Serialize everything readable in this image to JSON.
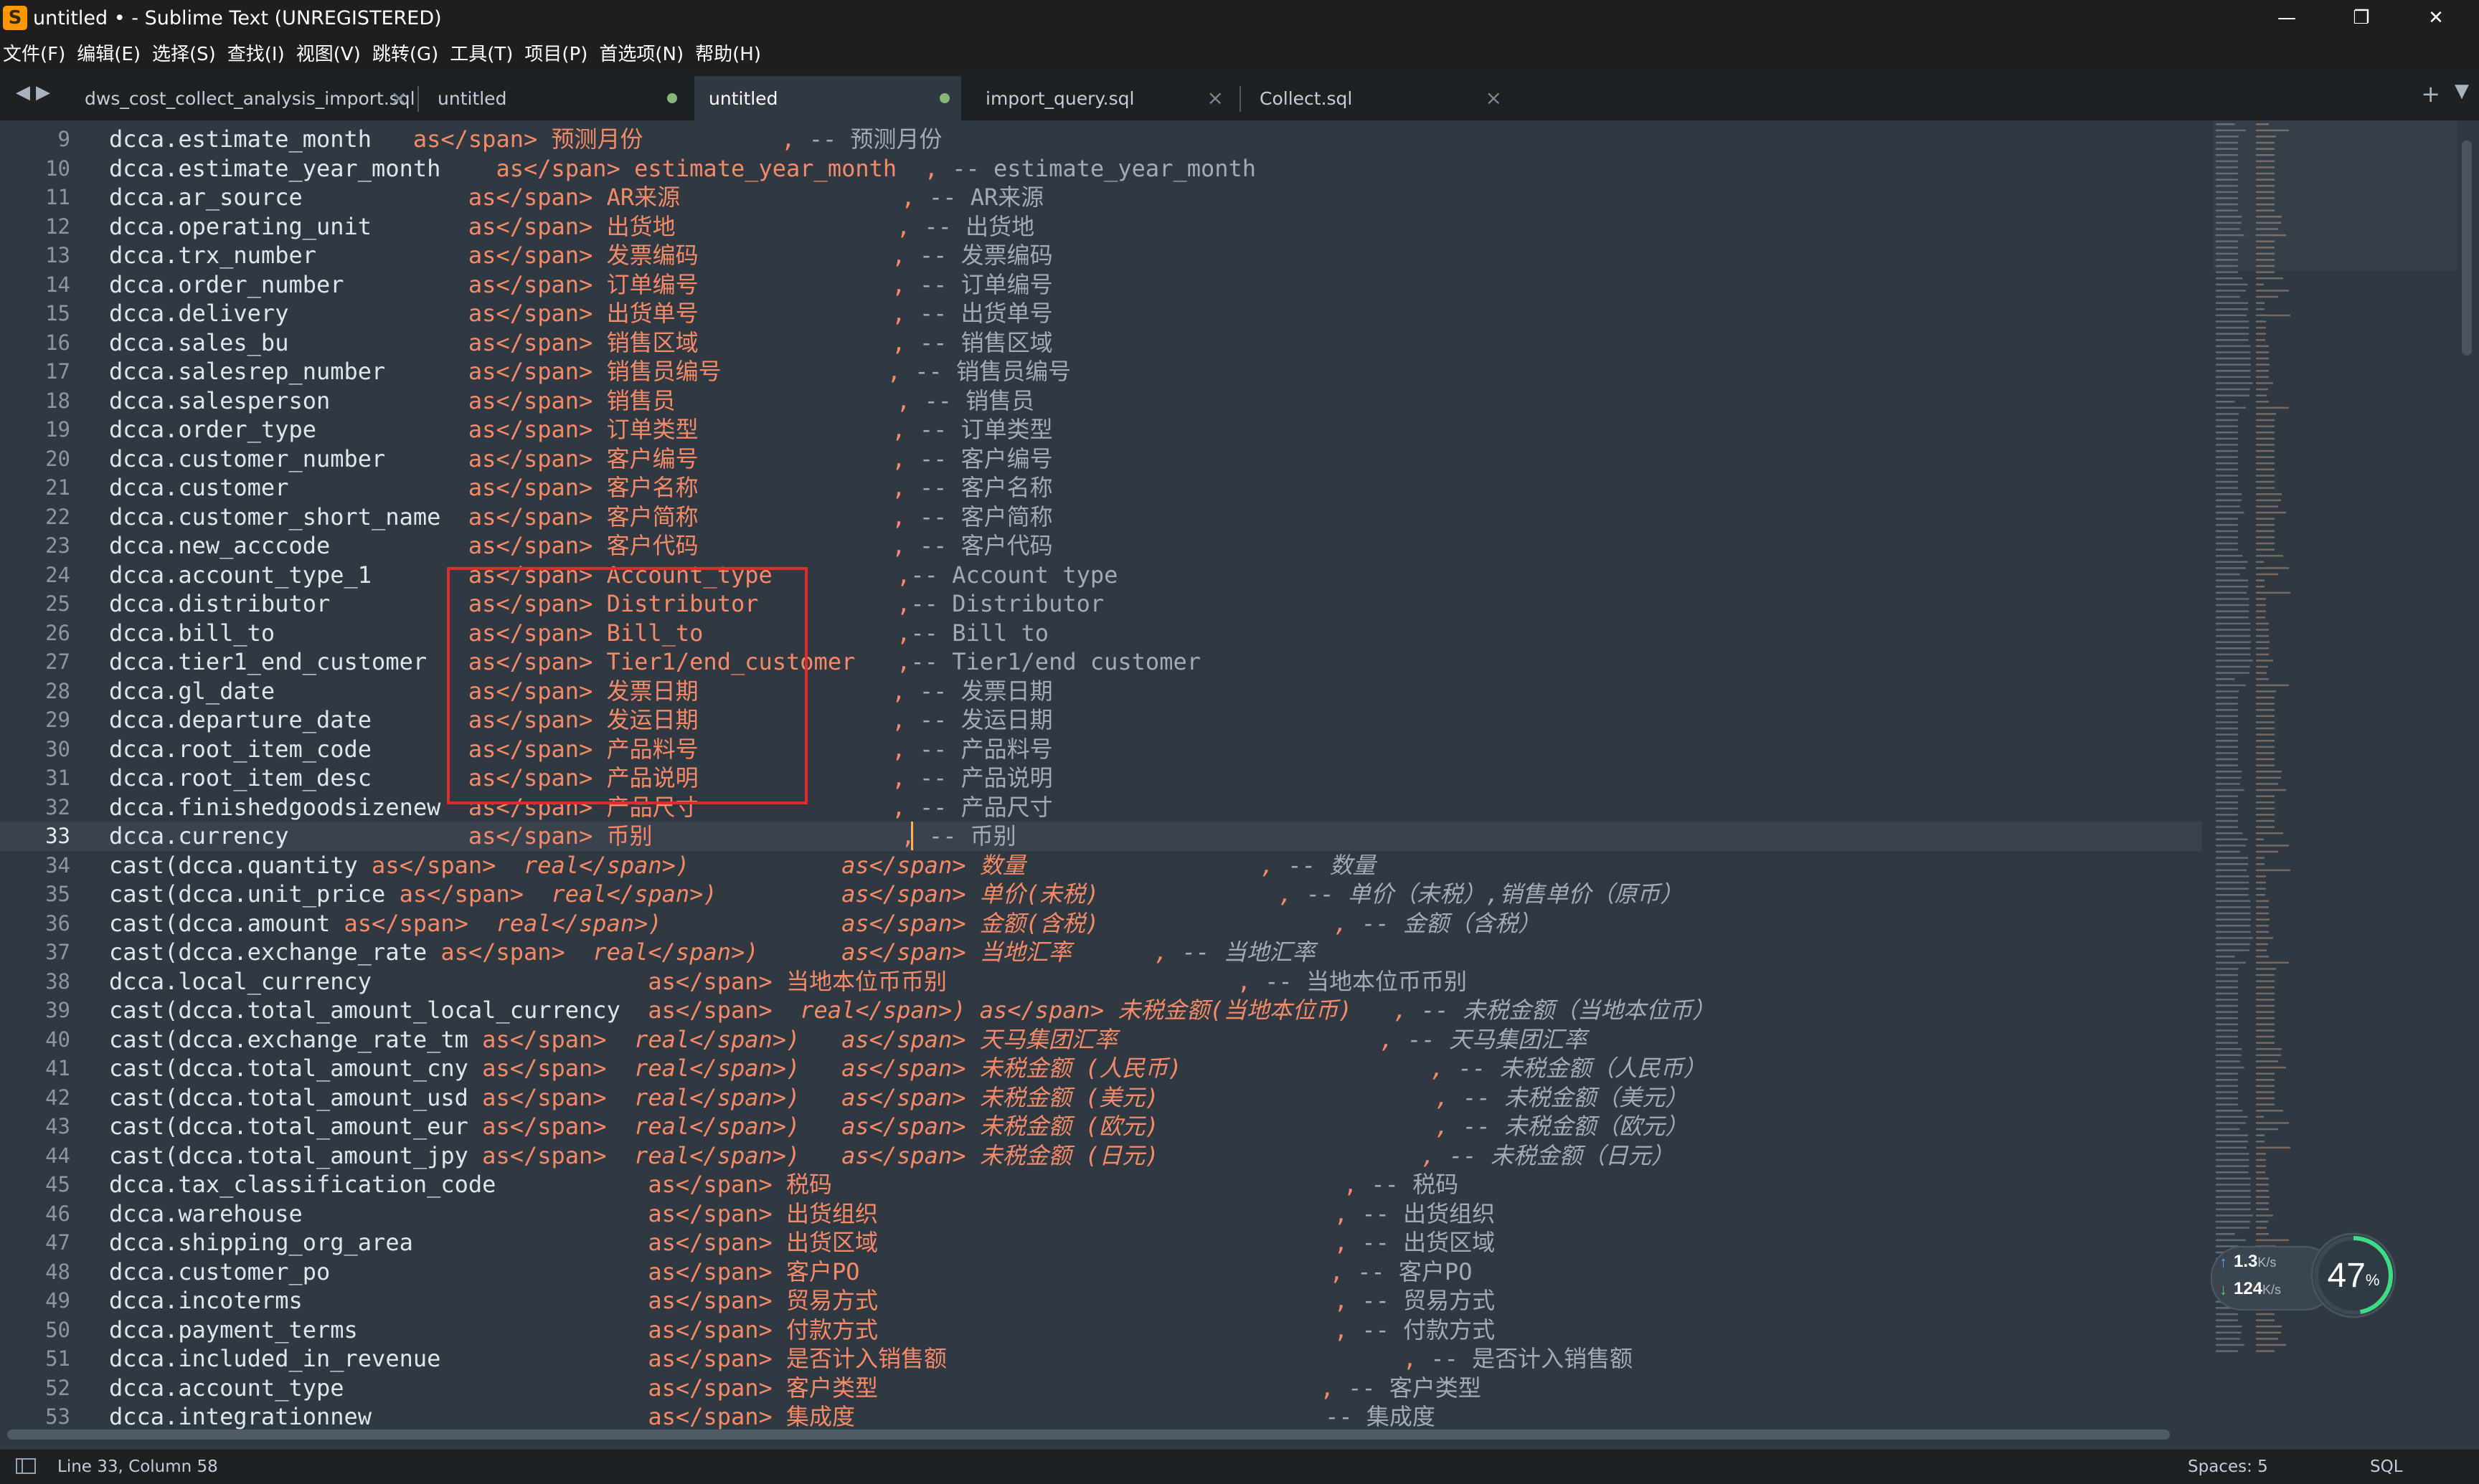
{
  "window": {
    "title": "untitled • - Sublime Text (UNREGISTERED)",
    "app_icon_glyph": "S",
    "minimize": "—",
    "restore": "❐",
    "close": "✕"
  },
  "menu": [
    "文件(F)",
    "编辑(E)",
    "选择(S)",
    "查找(I)",
    "视图(V)",
    "跳转(G)",
    "工具(T)",
    "项目(P)",
    "首选项(N)",
    "帮助(H)"
  ],
  "tabs": [
    {
      "label": "dws_cost_collect_analysis_import.sql",
      "state": "close"
    },
    {
      "label": "untitled",
      "state": "modified"
    },
    {
      "label": "untitled",
      "state": "modified",
      "active": true
    },
    {
      "label": "import_query.sql",
      "state": "close"
    },
    {
      "label": "Collect.sql",
      "state": "close"
    }
  ],
  "editor": {
    "current_line": 33,
    "lines": [
      {
        "n": "9",
        "t": "dcca.estimate_month   as 预测月份          , -- 预测月份"
      },
      {
        "n": "10",
        "t": "dcca.estimate_year_month    as estimate_year_month  , -- estimate_year_month"
      },
      {
        "n": "11",
        "t": "dcca.ar_source            as AR来源                , -- AR来源"
      },
      {
        "n": "12",
        "t": "dcca.operating_unit       as 出货地                , -- 出货地"
      },
      {
        "n": "13",
        "t": "dcca.trx_number           as 发票编码              , -- 发票编码"
      },
      {
        "n": "14",
        "t": "dcca.order_number         as 订单编号              , -- 订单编号"
      },
      {
        "n": "15",
        "t": "dcca.delivery             as 出货单号              , -- 出货单号"
      },
      {
        "n": "16",
        "t": "dcca.sales_bu             as 销售区域              , -- 销售区域"
      },
      {
        "n": "17",
        "t": "dcca.salesrep_number      as 销售员编号            , -- 销售员编号"
      },
      {
        "n": "18",
        "t": "dcca.salesperson          as 销售员                , -- 销售员"
      },
      {
        "n": "19",
        "t": "dcca.order_type           as 订单类型              , -- 订单类型"
      },
      {
        "n": "20",
        "t": "dcca.customer_number      as 客户编号              , -- 客户编号"
      },
      {
        "n": "21",
        "t": "dcca.customer             as 客户名称              , -- 客户名称"
      },
      {
        "n": "22",
        "t": "dcca.customer_short_name  as 客户简称              , -- 客户简称"
      },
      {
        "n": "23",
        "t": "dcca.new_acccode          as 客户代码              , -- 客户代码"
      },
      {
        "n": "24",
        "t": "dcca.account_type_1       as Account_type         ,-- Account type"
      },
      {
        "n": "25",
        "t": "dcca.distributor          as Distributor          ,-- Distributor"
      },
      {
        "n": "26",
        "t": "dcca.bill_to              as Bill_to              ,-- Bill to"
      },
      {
        "n": "27",
        "t": "dcca.tier1_end_customer   as Tier1/end_customer   ,-- Tier1/end customer"
      },
      {
        "n": "28",
        "t": "dcca.gl_date              as 发票日期              , -- 发票日期"
      },
      {
        "n": "29",
        "t": "dcca.departure_date       as 发运日期              , -- 发运日期"
      },
      {
        "n": "30",
        "t": "dcca.root_item_code       as 产品料号              , -- 产品料号"
      },
      {
        "n": "31",
        "t": "dcca.root_item_desc       as 产品说明              , -- 产品说明"
      },
      {
        "n": "32",
        "t": "dcca.finishedgoodsizenew  as 产品尺寸              , -- 产品尺寸"
      },
      {
        "n": "33",
        "t": "dcca.currency             as 币别                  , -- 币别"
      },
      {
        "n": "34",
        "t": "cast(dcca.quantity as  real)           as 数量                 , -- 数量"
      },
      {
        "n": "35",
        "t": "cast(dcca.unit_price as  real)         as 单价(未税)             , -- 单价（未税）,销售单价（原币）"
      },
      {
        "n": "36",
        "t": "cast(dcca.amount as  real)             as 金额(含税)                 , -- 金额（含税）"
      },
      {
        "n": "37",
        "t": "cast(dcca.exchange_rate as  real)      as 当地汇率      , -- 当地汇率"
      },
      {
        "n": "38",
        "t": "dcca.local_currency                    as 当地本位币币别                     , -- 当地本位币币别"
      },
      {
        "n": "39",
        "t": "cast(dcca.total_amount_local_currency  as  real) as 未税金额(当地本位币)   , -- 未税金额（当地本位币）"
      },
      {
        "n": "40",
        "t": "cast(dcca.exchange_rate_tm as  real)   as 天马集团汇率                   , -- 天马集团汇率"
      },
      {
        "n": "41",
        "t": "cast(dcca.total_amount_cny as  real)   as 未税金额 (人民币)                  , -- 未税金额（人民币）"
      },
      {
        "n": "42",
        "t": "cast(dcca.total_amount_usd as  real)   as 未税金额 (美元)                    , -- 未税金额（美元）"
      },
      {
        "n": "43",
        "t": "cast(dcca.total_amount_eur as  real)   as 未税金额 (欧元)                    , -- 未税金额（欧元）"
      },
      {
        "n": "44",
        "t": "cast(dcca.total_amount_jpy as  real)   as 未税金额 (日元)                   , -- 未税金额（日元）"
      },
      {
        "n": "45",
        "t": "dcca.tax_classification_code           as 税码                                     , -- 税码"
      },
      {
        "n": "46",
        "t": "dcca.warehouse                         as 出货组织                                 , -- 出货组织"
      },
      {
        "n": "47",
        "t": "dcca.shipping_org_area                 as 出货区域                                 , -- 出货区域"
      },
      {
        "n": "48",
        "t": "dcca.customer_po                       as 客户PO                                  , -- 客户PO"
      },
      {
        "n": "49",
        "t": "dcca.incoterms                         as 贸易方式                                 , -- 贸易方式"
      },
      {
        "n": "50",
        "t": "dcca.payment_terms                     as 付款方式                                 , -- 付款方式"
      },
      {
        "n": "51",
        "t": "dcca.included_in_revenue               as 是否计入销售额                                 , -- 是否计入销售额"
      },
      {
        "n": "52",
        "t": "dcca.account_type                      as 客户类型                                , -- 客户类型"
      },
      {
        "n": "53",
        "t": "dcca.integrationnew                    as 集成度                                  -- 集成度"
      }
    ]
  },
  "net_widget": {
    "upload": "1.3",
    "upload_unit": "K/s",
    "download": "124",
    "download_unit": "K/s",
    "cpu": "47",
    "cpu_unit": "%",
    "cpu_fraction": 0.47
  },
  "status": {
    "cursor": "Line 33, Column 58",
    "indent": "Spaces: 5",
    "syntax": "SQL"
  },
  "colors": {
    "keyword": "#f58a68",
    "comment": "#a2aab3",
    "background": "#303841",
    "highlight_box": "#e02b2b",
    "caret": "#ffb454"
  }
}
